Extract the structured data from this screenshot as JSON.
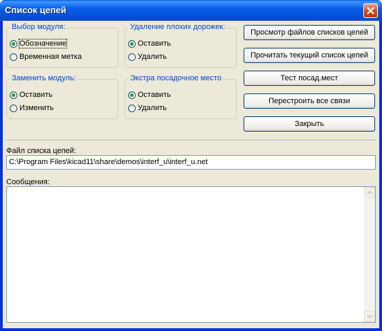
{
  "window": {
    "title": "Список цепей"
  },
  "groups": {
    "module_select": {
      "title": "Выбор модуля:",
      "options": [
        "Обозначение",
        "Временная метка"
      ]
    },
    "remove_bad_tracks": {
      "title": "Удаление плохих дорожек:",
      "options": [
        "Оставить",
        "Удалить"
      ]
    },
    "replace_module": {
      "title": "Заменить модуль:",
      "options": [
        "Оставить",
        "Изменить"
      ]
    },
    "extra_footprint": {
      "title": "Экстра посадочное место",
      "options": [
        "Оставить",
        "Удалить"
      ]
    }
  },
  "buttons": {
    "browse": "Просмотр файлов списков цепей",
    "read": "Прочитать текущий список цепей",
    "test": "Тест посад.мест",
    "rebuild": "Перестроить все связи",
    "close": "Закрыть"
  },
  "netlist": {
    "label": "Файл списка цепей:",
    "value": "C:\\Program Files\\kicad11\\share\\demos\\interf_u\\interf_u.net"
  },
  "messages": {
    "label": "Сообщения:",
    "value": ""
  },
  "colors": {
    "group_title": "#0046d5",
    "face": "#ece9d8",
    "titlebar": "#0a5fe9",
    "radio_dot": "#21a121"
  }
}
